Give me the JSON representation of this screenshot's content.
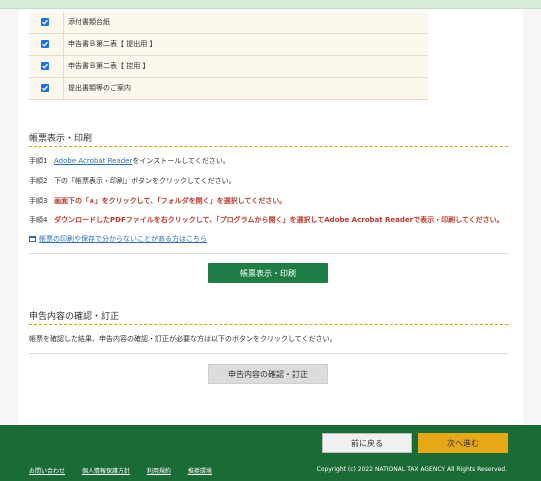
{
  "checklist": {
    "items": [
      {
        "label": "添付書類台紙",
        "checked": true
      },
      {
        "label": "申告書Ｂ第二表【 提出用 】",
        "checked": true
      },
      {
        "label": "申告書Ｂ第二表【 控用 】",
        "checked": true
      },
      {
        "label": "提出書類等のご案内",
        "checked": true
      }
    ]
  },
  "print_section": {
    "title": "帳票表示・印刷",
    "step1_num": "手順1",
    "step1_link": "Adobe Acrobat Reader",
    "step1_text": "をインストールしてください。",
    "step2_num": "手順2",
    "step2_text": "下の「帳票表示・印刷」ボタンをクリックしてください。",
    "step3_num": "手順3",
    "step3_text": "画面下の「∧」をクリックして、「フォルダを開く」を選択してください。",
    "step4_num": "手順4",
    "step4_text": "ダウンロードしたPDFファイルを右クリックして、「プログラムから開く」を選択してAdobe Acrobat Readerで表示・印刷してください。",
    "help_link": "帳票の印刷や保存で分からないことがある方はこちら",
    "button": "帳票表示・印刷"
  },
  "confirm_section": {
    "title": "申告内容の確認・訂正",
    "description": "帳票を確認した結果、申告内容の確認・訂正が必要な方は以下のボタンをクリックしてください。",
    "button": "申告内容の確認・訂正"
  },
  "footer": {
    "back_button": "前に戻る",
    "next_button": "次へ進む",
    "links": [
      "お問い合わせ",
      "個人情報保護方針",
      "利用規約",
      "推奨環境"
    ],
    "copyright": "Copyright (c) 2022 NATIONAL TAX AGENCY All Rights Reserved."
  },
  "colors": {
    "primary_green": "#1e7d45",
    "footer_green": "#1b6b34",
    "accent_orange": "#e8a714",
    "warning_red": "#c0392b",
    "link_blue": "#2a6ebb"
  }
}
